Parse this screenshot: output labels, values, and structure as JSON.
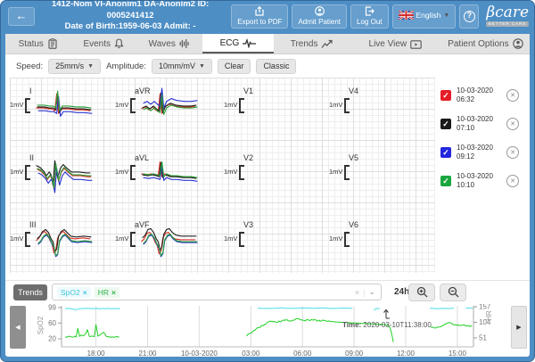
{
  "header": {
    "back": "←",
    "patient_line1": "1412-Nom VI-Anonim1 DA-Anonim2 ID: 0005241412",
    "patient_line2": "Date of Birth:1959-06-03 Admit: -",
    "export_pdf": "Export to PDF",
    "admit_patient": "Admit Patient",
    "log_out": "Log Out",
    "language": "English",
    "help": "?",
    "logo_brand": "βcare",
    "logo_tagline": "BETTER CARE"
  },
  "tabs": [
    {
      "label": "Status",
      "icon": "clipboard-icon",
      "active": false
    },
    {
      "label": "Events",
      "icon": "bell-icon",
      "active": false
    },
    {
      "label": "Waves",
      "icon": "waveform-icon",
      "active": false
    },
    {
      "label": "ECG",
      "icon": "ecg-icon",
      "active": true
    },
    {
      "label": "Trends",
      "icon": "trend-icon",
      "active": false
    },
    {
      "label": "Live View",
      "icon": "live-view-icon",
      "active": false
    },
    {
      "label": "Patient Options",
      "icon": "person-icon",
      "active": false
    }
  ],
  "toolbar": {
    "speed_label": "Speed:",
    "speed_value": "25mm/s",
    "amplitude_label": "Amplitude:",
    "amplitude_value": "10mm/mV",
    "clear": "Clear",
    "classic": "Classic"
  },
  "ecg": {
    "amplitude_label": "1mV",
    "lead_rows": [
      [
        "I",
        "aVR",
        "V1",
        "V4"
      ],
      [
        "II",
        "aVL",
        "V2",
        "V5"
      ],
      [
        "III",
        "aVF",
        "V3",
        "V6"
      ]
    ],
    "leads_with_waveform": [
      "I",
      "aVR",
      "II",
      "aVL",
      "III",
      "aVF"
    ],
    "trace_colors": {
      "red": "#d93025",
      "black": "#222222",
      "blue": "#2b35cf",
      "green": "#2b9f3c"
    },
    "trace_offsets": {
      "I": {
        "red": [
          0,
          1
        ],
        "black": [
          1,
          0
        ],
        "blue": [
          2,
          4
        ],
        "green": [
          1,
          -2
        ]
      },
      "aVR": {
        "red": [
          0,
          1
        ],
        "black": [
          1,
          0
        ],
        "blue": [
          2,
          -5
        ],
        "green": [
          2,
          2
        ]
      },
      "II": {
        "red": [
          1,
          2
        ],
        "black": [
          0,
          -2
        ],
        "blue": [
          2,
          6
        ],
        "green": [
          1,
          1
        ]
      },
      "aVL": {
        "red": [
          0,
          -1
        ],
        "black": [
          1,
          0
        ],
        "blue": [
          2,
          3
        ],
        "green": [
          2,
          -1
        ]
      },
      "III": {
        "red": [
          0,
          -2
        ],
        "black": [
          1,
          -4
        ],
        "blue": [
          2,
          2
        ],
        "green": [
          2,
          1
        ]
      },
      "aVF": {
        "red": [
          0,
          -1
        ],
        "black": [
          1,
          -5
        ],
        "blue": [
          2,
          2
        ],
        "green": [
          2,
          1
        ]
      }
    },
    "waveforms": {
      "I": [
        [
          2,
          22
        ],
        [
          10,
          22
        ],
        [
          15,
          23
        ],
        [
          19,
          23
        ],
        [
          22,
          25
        ],
        [
          24,
          7
        ],
        [
          26,
          28
        ],
        [
          29,
          23
        ],
        [
          36,
          23
        ],
        [
          44,
          24
        ],
        [
          52,
          24
        ],
        [
          60,
          25
        ]
      ],
      "aVR": [
        [
          2,
          23
        ],
        [
          6,
          21
        ],
        [
          10,
          24
        ],
        [
          14,
          21
        ],
        [
          17,
          24
        ],
        [
          20,
          26
        ],
        [
          22,
          7
        ],
        [
          24,
          28
        ],
        [
          27,
          21
        ],
        [
          32,
          18
        ],
        [
          38,
          20
        ],
        [
          46,
          21
        ],
        [
          54,
          21
        ],
        [
          60,
          20
        ]
      ],
      "II": [
        [
          2,
          15
        ],
        [
          6,
          17
        ],
        [
          10,
          21
        ],
        [
          13,
          26
        ],
        [
          16,
          22
        ],
        [
          18,
          25
        ],
        [
          20,
          36
        ],
        [
          22,
          10
        ],
        [
          25,
          28
        ],
        [
          28,
          18
        ],
        [
          31,
          14
        ],
        [
          35,
          18
        ],
        [
          40,
          22
        ],
        [
          48,
          22
        ],
        [
          56,
          23
        ],
        [
          60,
          23
        ]
      ],
      "aVL": [
        [
          2,
          23
        ],
        [
          8,
          24
        ],
        [
          13,
          23
        ],
        [
          17,
          24
        ],
        [
          20,
          25
        ],
        [
          22,
          10
        ],
        [
          24,
          26
        ],
        [
          27,
          23
        ],
        [
          32,
          25
        ],
        [
          38,
          25
        ],
        [
          46,
          26
        ],
        [
          54,
          26
        ],
        [
          60,
          27
        ]
      ],
      "III": [
        [
          2,
          24
        ],
        [
          5,
          21
        ],
        [
          8,
          16
        ],
        [
          11,
          14
        ],
        [
          14,
          17
        ],
        [
          17,
          24
        ],
        [
          19,
          27
        ],
        [
          21,
          37
        ],
        [
          23,
          35
        ],
        [
          25,
          21
        ],
        [
          28,
          16
        ],
        [
          31,
          14
        ],
        [
          34,
          17
        ],
        [
          38,
          21
        ],
        [
          44,
          22
        ],
        [
          52,
          21
        ],
        [
          60,
          22
        ]
      ],
      "aVF": [
        [
          2,
          24
        ],
        [
          5,
          21
        ],
        [
          8,
          15
        ],
        [
          11,
          14
        ],
        [
          14,
          18
        ],
        [
          17,
          25
        ],
        [
          19,
          28
        ],
        [
          21,
          37
        ],
        [
          23,
          34
        ],
        [
          25,
          20
        ],
        [
          28,
          15
        ],
        [
          31,
          14
        ],
        [
          34,
          18
        ],
        [
          38,
          21
        ],
        [
          44,
          22
        ],
        [
          52,
          22
        ],
        [
          60,
          22
        ]
      ]
    }
  },
  "snapshots": [
    {
      "date": "10-03-2020",
      "time": "06:32",
      "color": "#e41e26",
      "checked": true
    },
    {
      "date": "10-03-2020",
      "time": "07:10",
      "color": "#1a1a1a",
      "checked": true
    },
    {
      "date": "10-03-2020",
      "time": "09:12",
      "color": "#2427de",
      "checked": true
    },
    {
      "date": "10-03-2020",
      "time": "10:10",
      "color": "#19a63e",
      "checked": true
    }
  ],
  "trends": {
    "button": "Trends",
    "tags": [
      {
        "label": "SpO2",
        "color": "#3fc6dc",
        "bg": "#eefafc"
      },
      {
        "label": "HR",
        "color": "#2db34b",
        "bg": "#edf9ef"
      }
    ],
    "remove_x": "×",
    "clear_x": "×",
    "caret": "⌄",
    "range": "24h"
  },
  "chart_data": {
    "type": "line",
    "title": "",
    "x_axis": {
      "ticks": [
        "18:00",
        "21:00",
        "10-03-2020",
        "03:00",
        "06:00",
        "09:00",
        "12:00",
        "15:00"
      ],
      "tick_hours": [
        2,
        5,
        8,
        11,
        14,
        17,
        20,
        23
      ],
      "span_hours": 24
    },
    "left_axis": {
      "label": "SpO2",
      "ticks": [
        99,
        60,
        20
      ]
    },
    "right_axis": {
      "label": "HR",
      "ticks": [
        157,
        104,
        51
      ]
    },
    "tooltip": {
      "label": "Time:",
      "value": "2020-03-10T11:38:00"
    },
    "series": [
      {
        "name": "SpO2",
        "axis": "left",
        "color": "#4bdde8",
        "segments": [
          {
            "jitter": 0.6,
            "points": [
              [
                0.2,
                97
              ],
              [
                0.5,
                96.5
              ],
              [
                0.8,
                93.5
              ],
              [
                1.0,
                96
              ],
              [
                1.4,
                97
              ],
              [
                1.9,
                96.5
              ],
              [
                2.3,
                96
              ],
              [
                2.7,
                97
              ],
              [
                3.1,
                96.5
              ],
              [
                3.4,
                97
              ]
            ]
          },
          {
            "jitter": 0.5,
            "points": [
              [
                11.4,
                97.5
              ],
              [
                11.8,
                97
              ],
              [
                12.3,
                97.5
              ],
              [
                12.9,
                98
              ],
              [
                13.4,
                97
              ],
              [
                13.9,
                98
              ],
              [
                14.5,
                97.5
              ],
              [
                15.1,
                98
              ],
              [
                15.7,
                97
              ],
              [
                16.3,
                97.5
              ],
              [
                16.9,
                97.5
              ]
            ]
          },
          {
            "jitter": 0.2,
            "points": [
              [
                18.15,
                92
              ],
              [
                18.3,
                97
              ],
              [
                18.5,
                96.5
              ]
            ]
          },
          {
            "jitter": 0.5,
            "points": [
              [
                21.4,
                97
              ],
              [
                21.9,
                96.5
              ],
              [
                22.4,
                97
              ],
              [
                22.8,
                97
              ]
            ]
          },
          {
            "jitter": 0.3,
            "points": [
              [
                23.5,
                98
              ],
              [
                23.9,
                97.5
              ]
            ]
          }
        ]
      },
      {
        "name": "HR",
        "axis": "right",
        "color": "#1fcf23",
        "segments": [
          {
            "jitter": 2.5,
            "points": [
              [
                0.2,
                53
              ],
              [
                0.55,
                55
              ],
              [
                0.85,
                54
              ],
              [
                0.95,
                83
              ],
              [
                1.05,
                56
              ],
              [
                1.35,
                62
              ],
              [
                1.5,
                79
              ],
              [
                1.62,
                56
              ],
              [
                1.9,
                55
              ],
              [
                2.0,
                96
              ],
              [
                2.12,
                57
              ],
              [
                2.45,
                70
              ],
              [
                2.6,
                56
              ],
              [
                2.95,
                55
              ],
              [
                3.35,
                54
              ]
            ]
          },
          {
            "jitter": 2.5,
            "points": [
              [
                10.75,
                57
              ],
              [
                11.1,
                72
              ],
              [
                11.45,
                86
              ],
              [
                11.8,
                96
              ],
              [
                12.1,
                108
              ],
              [
                12.5,
                104
              ],
              [
                12.9,
                112
              ],
              [
                13.3,
                109
              ],
              [
                13.7,
                116
              ],
              [
                14.1,
                110
              ],
              [
                14.5,
                113
              ],
              [
                14.9,
                109
              ],
              [
                15.3,
                111
              ],
              [
                15.6,
                107
              ]
            ]
          },
          {
            "jitter": 0.3,
            "points": [
              [
                15.6,
                107
              ],
              [
                16.2,
                104
              ],
              [
                16.9,
                102
              ],
              [
                17.6,
                100
              ],
              [
                18.3,
                98
              ],
              [
                18.8,
                96
              ],
              [
                19.0,
                93
              ],
              [
                19.1,
                85
              ],
              [
                19.2,
                60
              ],
              [
                19.28,
                37
              ]
            ]
          },
          {
            "jitter": 2.2,
            "points": [
              [
                21.45,
                87
              ],
              [
                21.75,
                85
              ],
              [
                22.05,
                89
              ],
              [
                22.35,
                99
              ],
              [
                22.55,
                103
              ],
              [
                22.75,
                96
              ],
              [
                23.0,
                93
              ],
              [
                23.3,
                95
              ],
              [
                23.6,
                92
              ],
              [
                23.85,
                91
              ]
            ]
          }
        ]
      }
    ]
  }
}
